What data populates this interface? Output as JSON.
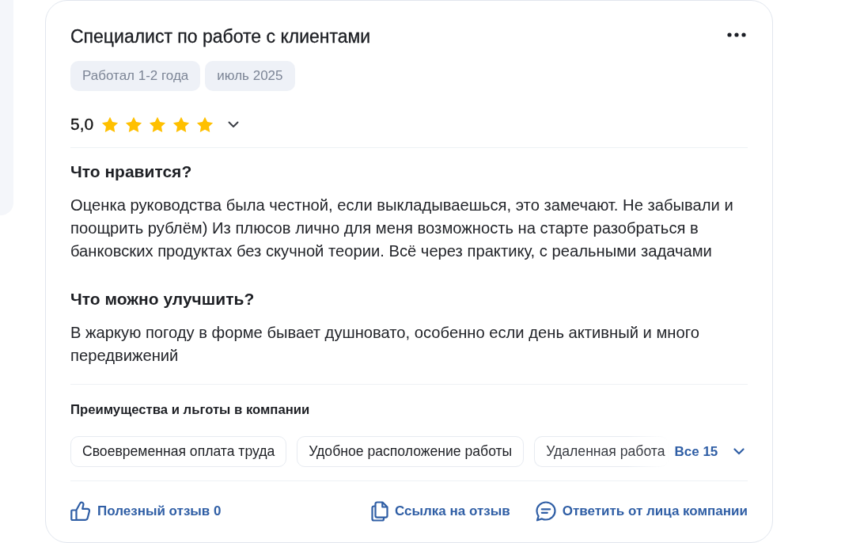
{
  "review": {
    "title": "Специалист по работе с клиентами",
    "tags": [
      "Работал 1-2 года",
      "июль 2025"
    ],
    "rating": {
      "score": "5,0",
      "stars": 5
    },
    "sections": [
      {
        "heading": "Что нравится?",
        "text": "Оценка руководства была честной, если выкладываешься, это замечают. Не забывали и поощрить рублём) Из плюсов лично для меня возможность на старте разобраться в банковских продуктах без скучной теории. Всё через практику, с реальными задачами"
      },
      {
        "heading": "Что можно улучшить?",
        "text": "В жаркую погоду в форме бывает душновато, особенно если день активный и много передвижений"
      }
    ],
    "benefits": {
      "title": "Преимущества и льготы в компании",
      "items": [
        {
          "label": "Своевременная оплата труда",
          "faded": false
        },
        {
          "label": "Удобное расположение работы",
          "faded": false
        },
        {
          "label": "Удаленная работа",
          "faded": true
        }
      ],
      "more": "Все 15"
    },
    "actions": [
      {
        "kind": "like",
        "label": "Полезный отзыв 0"
      },
      {
        "kind": "link",
        "label": "Ссылка на отзыв"
      },
      {
        "kind": "reply",
        "label": "Ответить от лица компании"
      }
    ]
  }
}
